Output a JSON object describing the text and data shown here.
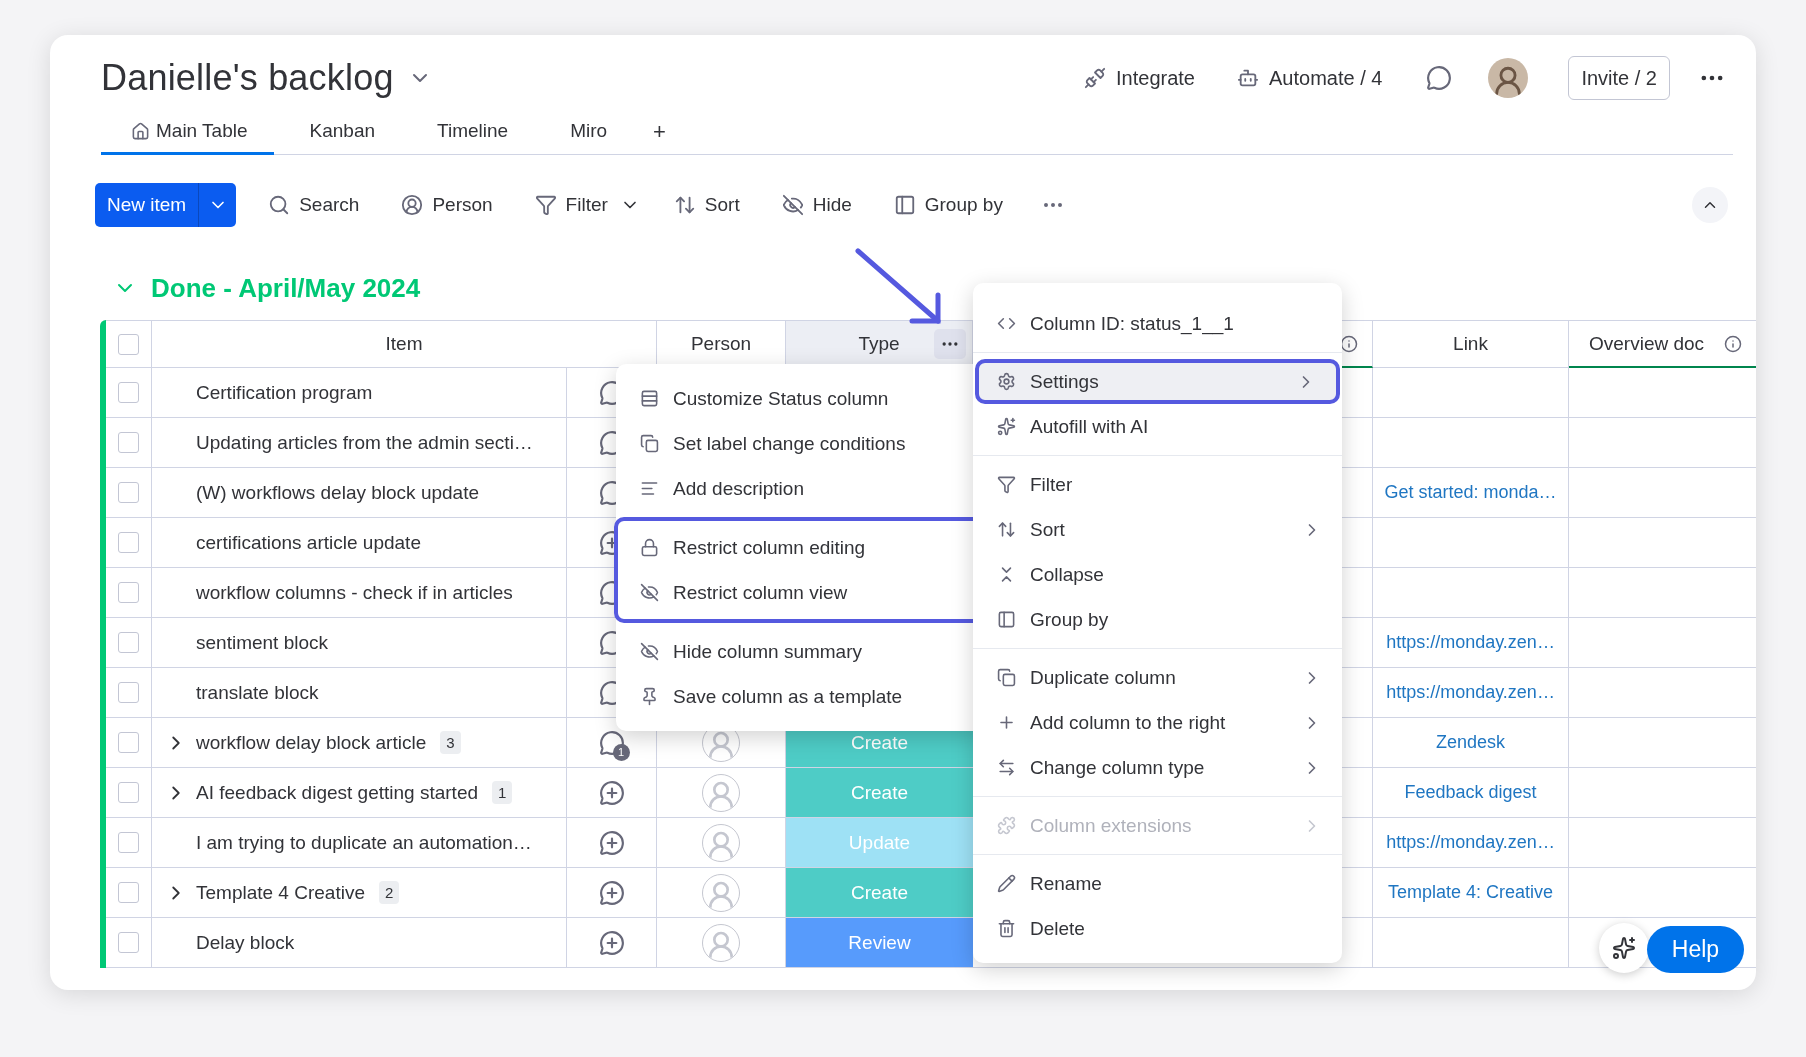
{
  "board": {
    "title": "Danielle's backlog"
  },
  "header_actions": [
    {
      "kind": "integrate",
      "label": "Integrate"
    },
    {
      "kind": "automate",
      "label": "Automate / 4"
    }
  ],
  "invite_button": "Invite / 2",
  "tabs": [
    {
      "label": "Main Table",
      "selected": true
    },
    {
      "label": "Kanban",
      "selected": false
    },
    {
      "label": "Timeline",
      "selected": false
    },
    {
      "label": "Miro",
      "selected": false
    }
  ],
  "add_tab": "+",
  "toolbar": {
    "new_item": "New item",
    "actions": [
      {
        "kind": "search",
        "label": "Search",
        "dropdown": false
      },
      {
        "kind": "person",
        "label": "Person",
        "dropdown": false
      },
      {
        "kind": "filter",
        "label": "Filter",
        "dropdown": true
      },
      {
        "kind": "sort",
        "label": "Sort",
        "dropdown": false
      },
      {
        "kind": "hide",
        "label": "Hide",
        "dropdown": false
      },
      {
        "kind": "group",
        "label": "Group by",
        "dropdown": false
      }
    ]
  },
  "group": {
    "title": "Done - April/May 2024",
    "expanded": true
  },
  "table": {
    "headers": {
      "item": "Item",
      "person": "Person",
      "type": "Type",
      "link": "Link",
      "overview": "Overview doc"
    },
    "type_header_active": true,
    "header_checked": false,
    "rows": [
      {
        "checked": false,
        "item": "Certification program",
        "expandable": false,
        "updates": {
          "kind": "chat"
        }
      },
      {
        "checked": false,
        "item": "Updating articles from the admin secti…",
        "expandable": false,
        "updates": {
          "kind": "chat"
        }
      },
      {
        "checked": false,
        "item": "(W) workflows delay block update",
        "expandable": false,
        "updates": {
          "kind": "chat"
        },
        "link": "Get started: monda…"
      },
      {
        "checked": false,
        "item": "certifications article update",
        "expandable": false,
        "updates": {
          "kind": "add"
        }
      },
      {
        "checked": false,
        "item": "workflow columns - check if in articles",
        "expandable": false,
        "updates": {
          "kind": "chat"
        }
      },
      {
        "checked": false,
        "item": "sentiment block",
        "expandable": false,
        "updates": {
          "kind": "chat"
        },
        "link": "https://monday.zen…"
      },
      {
        "checked": false,
        "item": "translate block",
        "expandable": false,
        "updates": {
          "kind": "chat"
        },
        "link": "https://monday.zen…"
      },
      {
        "checked": false,
        "item": "workflow delay block article",
        "expandable": true,
        "subitems": "3",
        "updates": {
          "kind": "chat",
          "badge": "1"
        },
        "status": {
          "label": "Create",
          "color": "#4eccc6"
        },
        "link": "Zendesk"
      },
      {
        "checked": false,
        "item": "AI feedback digest getting started",
        "expandable": true,
        "subitems": "1",
        "updates": {
          "kind": "add"
        },
        "status": {
          "label": "Create",
          "color": "#4eccc6"
        },
        "link": "Feedback digest"
      },
      {
        "checked": false,
        "item": "I am trying to duplicate an automation…",
        "expandable": false,
        "updates": {
          "kind": "add"
        },
        "status": {
          "label": "Update",
          "color": "#9ee1f5"
        },
        "link": "https://monday.zen…"
      },
      {
        "checked": false,
        "item": "Template 4 Creative",
        "expandable": true,
        "subitems": "2",
        "updates": {
          "kind": "add"
        },
        "status": {
          "label": "Create",
          "color": "#4eccc6"
        },
        "link": "Template 4: Creative"
      },
      {
        "checked": false,
        "item": "Delay block",
        "expandable": false,
        "updates": {
          "kind": "add"
        },
        "status": {
          "label": "Review",
          "color": "#579bfc"
        }
      }
    ]
  },
  "column_menu": {
    "sections": [
      {
        "outlined": false,
        "items": [
          "Customize Status column",
          "Set label change conditions",
          "Add description"
        ]
      },
      {
        "outlined": true,
        "items": [
          "Restrict column editing",
          "Restrict column view"
        ]
      },
      {
        "outlined": false,
        "items": [
          "Hide column summary",
          "Save column as a template"
        ]
      }
    ]
  },
  "options_menu": {
    "sections": [
      [
        {
          "label": "Column ID: status_1__1",
          "selected": false,
          "outlined": false,
          "disabled": false,
          "submenu": false
        }
      ],
      [
        {
          "label": "Settings",
          "selected": true,
          "outlined": true,
          "disabled": false,
          "submenu": true
        },
        {
          "label": "Autofill with AI",
          "selected": false,
          "outlined": false,
          "disabled": false,
          "submenu": false
        }
      ],
      [
        {
          "label": "Filter",
          "selected": false,
          "outlined": false,
          "disabled": false,
          "submenu": false
        },
        {
          "label": "Sort",
          "selected": false,
          "outlined": false,
          "disabled": false,
          "submenu": true
        },
        {
          "label": "Collapse",
          "selected": false,
          "outlined": false,
          "disabled": false,
          "submenu": false
        },
        {
          "label": "Group by",
          "selected": false,
          "outlined": false,
          "disabled": false,
          "submenu": false
        }
      ],
      [
        {
          "label": "Duplicate column",
          "selected": false,
          "outlined": false,
          "disabled": false,
          "submenu": true
        },
        {
          "label": "Add column to the right",
          "selected": false,
          "outlined": false,
          "disabled": false,
          "submenu": true
        },
        {
          "label": "Change column type",
          "selected": false,
          "outlined": false,
          "disabled": false,
          "submenu": true
        }
      ],
      [
        {
          "label": "Column extensions",
          "selected": false,
          "outlined": false,
          "disabled": true,
          "submenu": true
        }
      ],
      [
        {
          "label": "Rename",
          "selected": false,
          "outlined": false,
          "disabled": false,
          "submenu": false
        },
        {
          "label": "Delete",
          "selected": false,
          "outlined": false,
          "disabled": false,
          "submenu": false
        }
      ]
    ]
  },
  "help_button": "Help"
}
